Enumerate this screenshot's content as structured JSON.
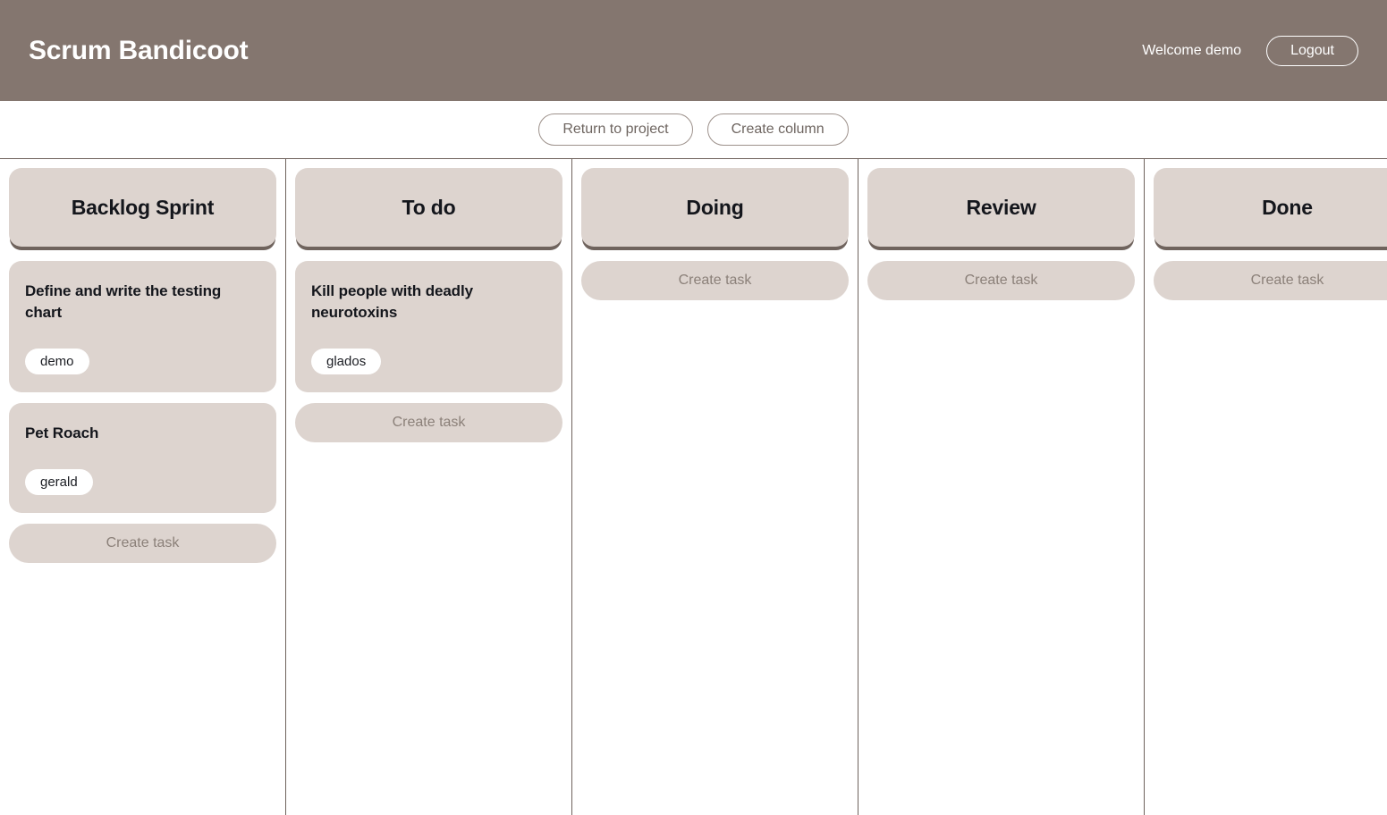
{
  "header": {
    "app_title": "Scrum Bandicoot",
    "welcome_text": "Welcome demo",
    "logout_label": "Logout",
    "background_color": "#84766F"
  },
  "toolbar": {
    "return_to_project_label": "Return to project",
    "create_column_label": "Create column"
  },
  "board": {
    "create_task_label": "Create task",
    "card_color": "#DDD4CF",
    "divider_color": "#6F635D",
    "columns": [
      {
        "title": "Backlog Sprint",
        "tasks": [
          {
            "title": "Define and write the testing chart",
            "badges": [
              "demo"
            ]
          },
          {
            "title": "Pet Roach",
            "badges": [
              "gerald"
            ]
          }
        ]
      },
      {
        "title": "To do",
        "tasks": [
          {
            "title": "Kill people with deadly neurotoxins",
            "badges": [
              "glados"
            ]
          }
        ]
      },
      {
        "title": "Doing",
        "tasks": []
      },
      {
        "title": "Review",
        "tasks": []
      },
      {
        "title": "Done",
        "tasks": []
      }
    ]
  }
}
